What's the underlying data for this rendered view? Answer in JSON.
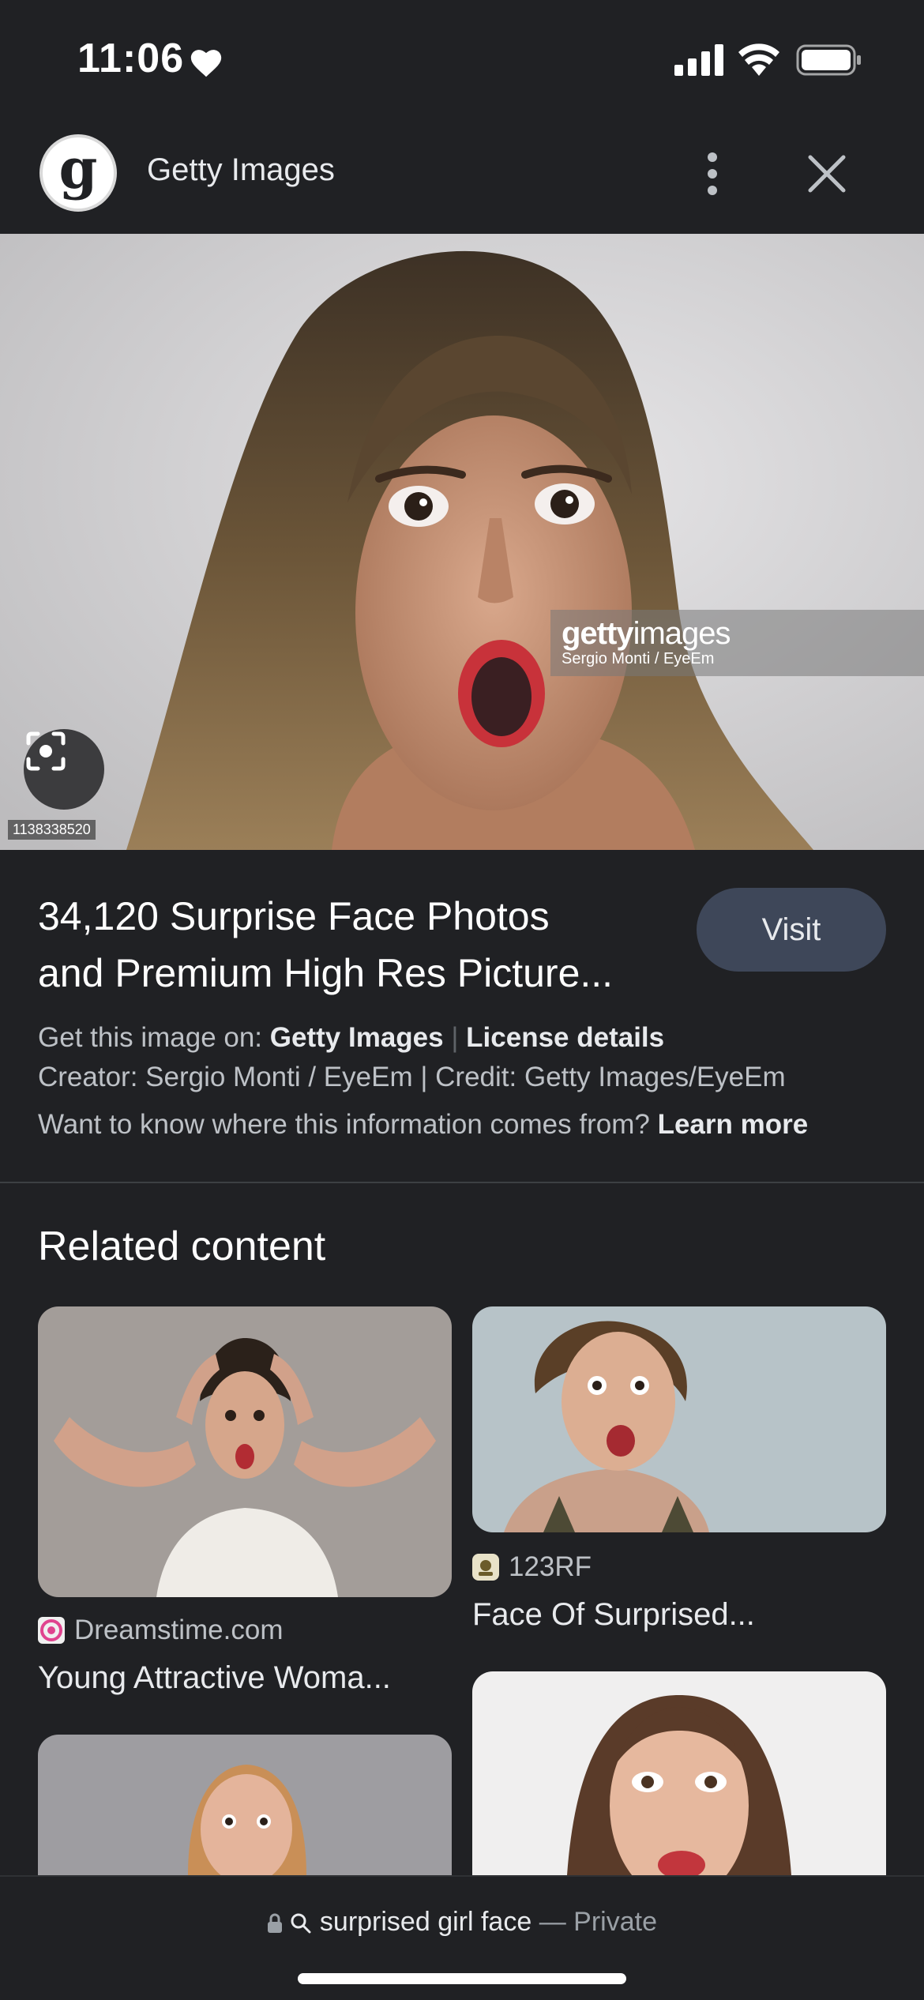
{
  "status_bar": {
    "time": "11:06"
  },
  "header": {
    "site_logo_letter": "g",
    "site_name": "Getty Images"
  },
  "main_image": {
    "watermark_logo_bold": "getty",
    "watermark_logo_light": "images",
    "watermark_credit": "Sergio Monti / EyeEm",
    "image_id": "1138338520"
  },
  "info": {
    "title_line1": "34,120 Surprise Face Photos",
    "title_line2": "and Premium High Res Picture...",
    "visit_label": "Visit",
    "get_image_prefix": "Get this image on:",
    "get_image_source": "Getty Images",
    "separator": "|",
    "license_label": "License details",
    "creator_line": "Creator: Sergio Monti / EyeEm | Credit: Getty Images/EyeEm",
    "info_question": "Want to know where this information comes from?",
    "learn_more": "Learn more"
  },
  "related": {
    "heading": "Related content",
    "cards": [
      {
        "source": "Dreamstime.com",
        "title": "Young Attractive Woma..."
      },
      {
        "source": "123RF",
        "title": "Face Of Surprised..."
      }
    ]
  },
  "bottom_bar": {
    "query": "surprised girl face",
    "separator": "—",
    "mode": "Private"
  },
  "colors": {
    "background": "#202124",
    "visit_button": "#3e4759",
    "text_primary": "#e8eaed",
    "text_secondary": "#bdc1c6"
  }
}
